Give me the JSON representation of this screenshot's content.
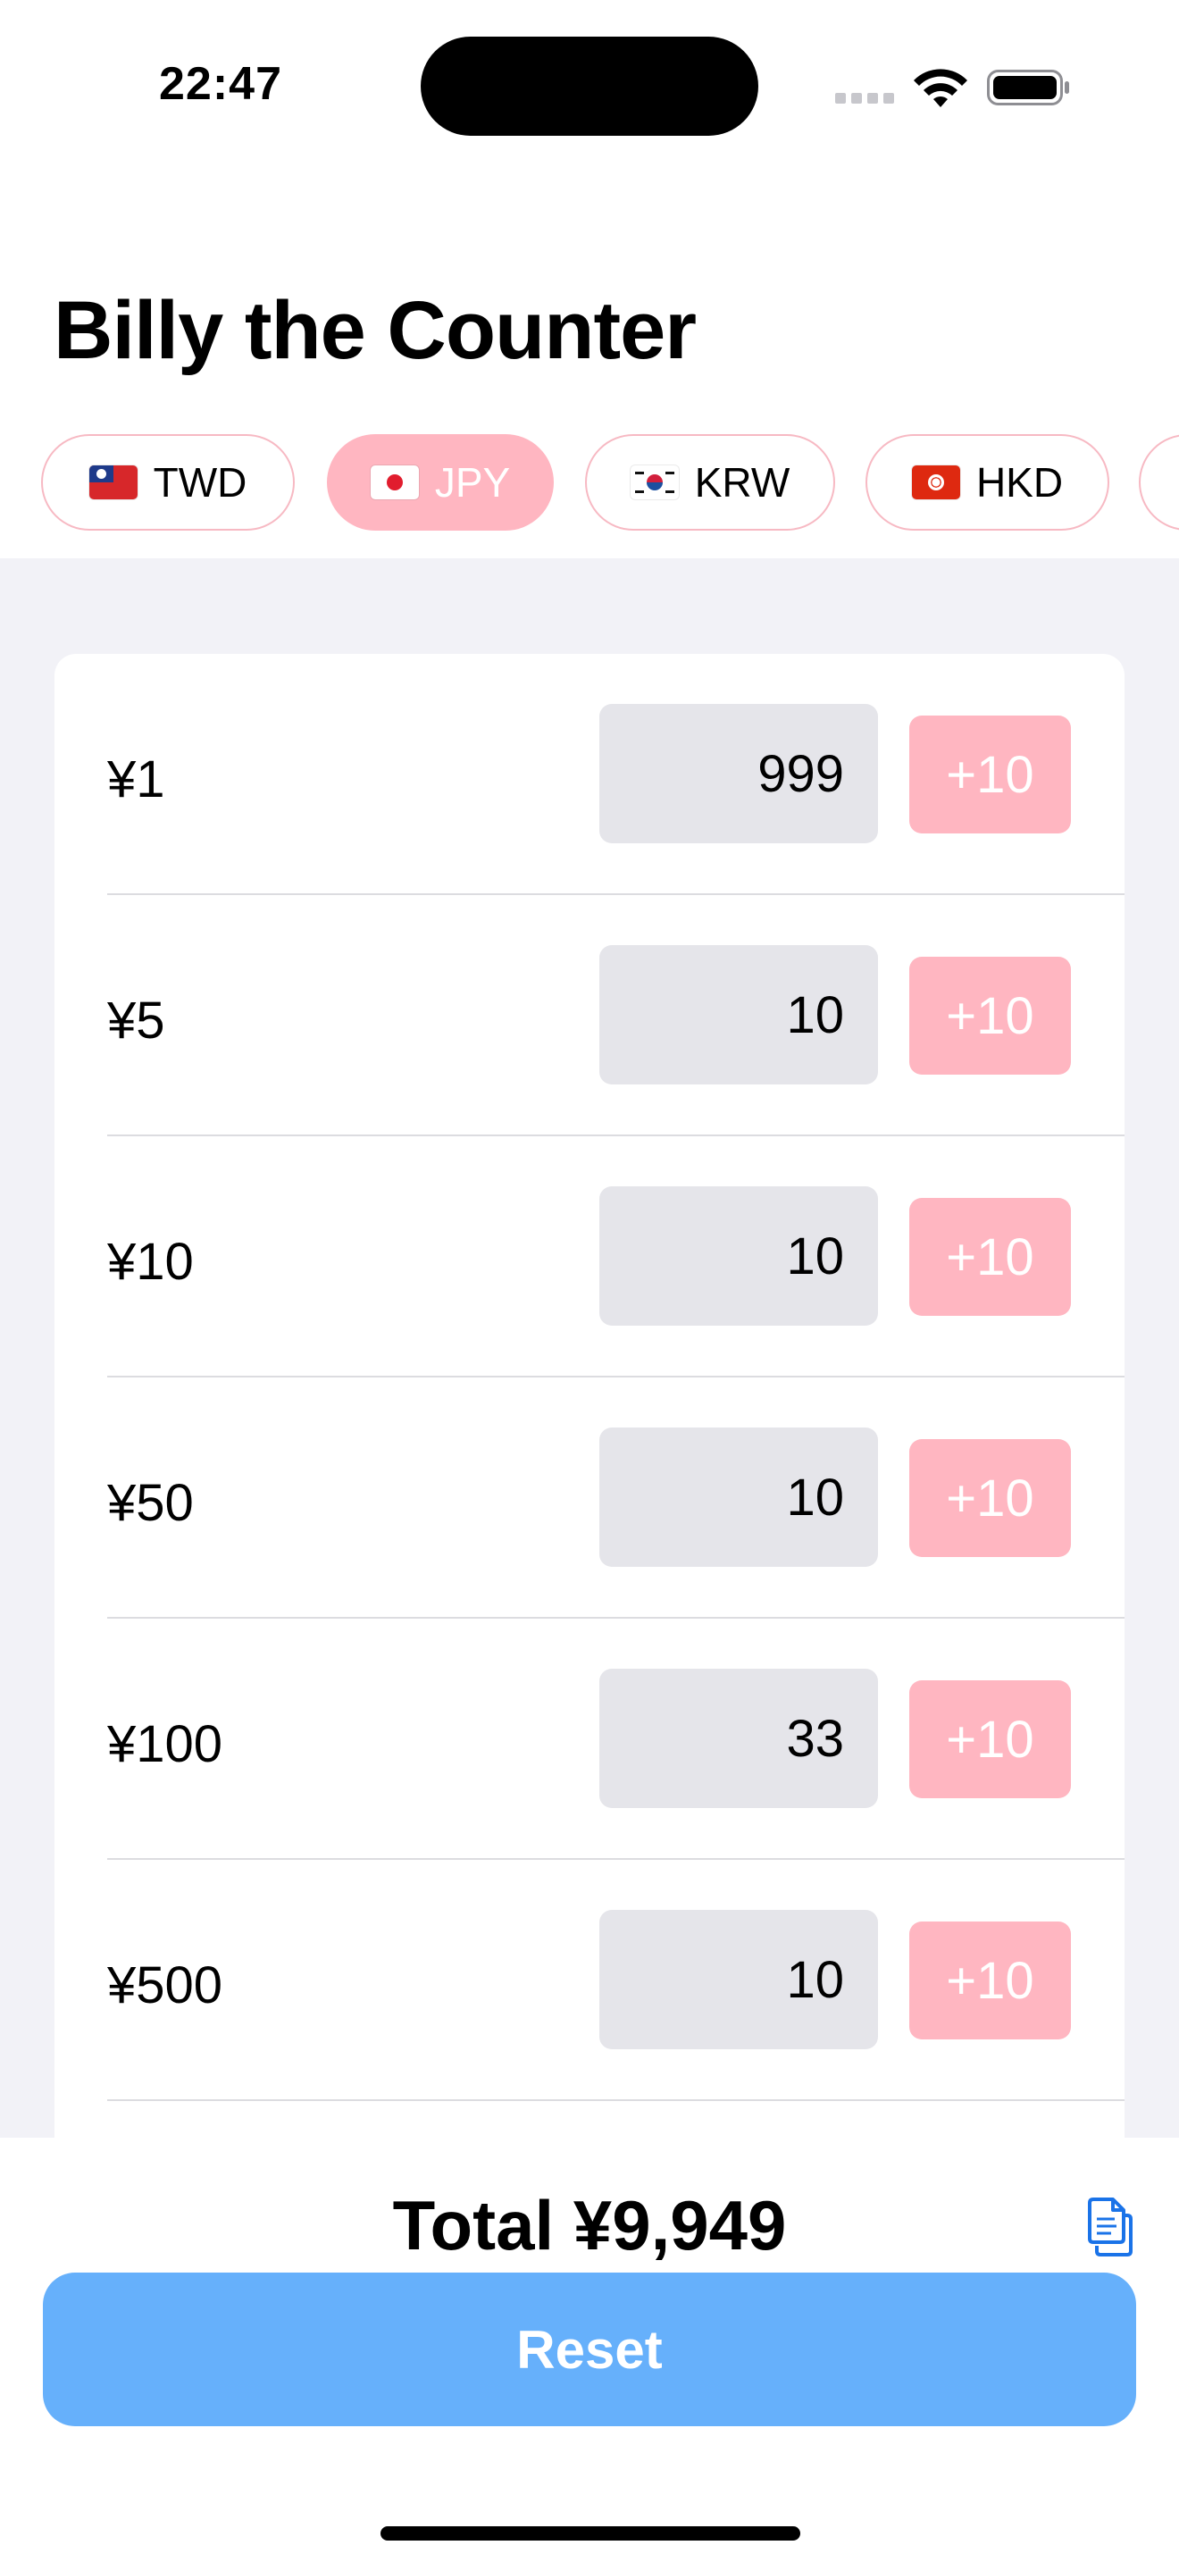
{
  "status_bar": {
    "time": "22:47",
    "icons": [
      "cellular-signal-icon",
      "wifi-icon",
      "battery-icon"
    ]
  },
  "title": "Billy the Counter",
  "currencies": [
    {
      "code": "TWD",
      "flag": "taiwan-flag-icon",
      "selected": false
    },
    {
      "code": "JPY",
      "flag": "japan-flag-icon",
      "selected": true
    },
    {
      "code": "KRW",
      "flag": "south-korea-flag-icon",
      "selected": false
    },
    {
      "code": "HKD",
      "flag": "hong-kong-flag-icon",
      "selected": false
    }
  ],
  "denominations": [
    {
      "label": "¥1",
      "count": "999",
      "button": "+10"
    },
    {
      "label": "¥5",
      "count": "10",
      "button": "+10"
    },
    {
      "label": "¥10",
      "count": "10",
      "button": "+10"
    },
    {
      "label": "¥50",
      "count": "10",
      "button": "+10"
    },
    {
      "label": "¥100",
      "count": "33",
      "button": "+10"
    },
    {
      "label": "¥500",
      "count": "10",
      "button": "+10"
    }
  ],
  "total_text": "Total ¥9,949",
  "copy_icon": "copy-icon",
  "reset_label": "Reset",
  "colors": {
    "accent_pink": "#ffb6c1",
    "reset_blue": "#66b0fb",
    "field_gray": "#e5e5ea",
    "background_gray": "#f2f2f7"
  }
}
